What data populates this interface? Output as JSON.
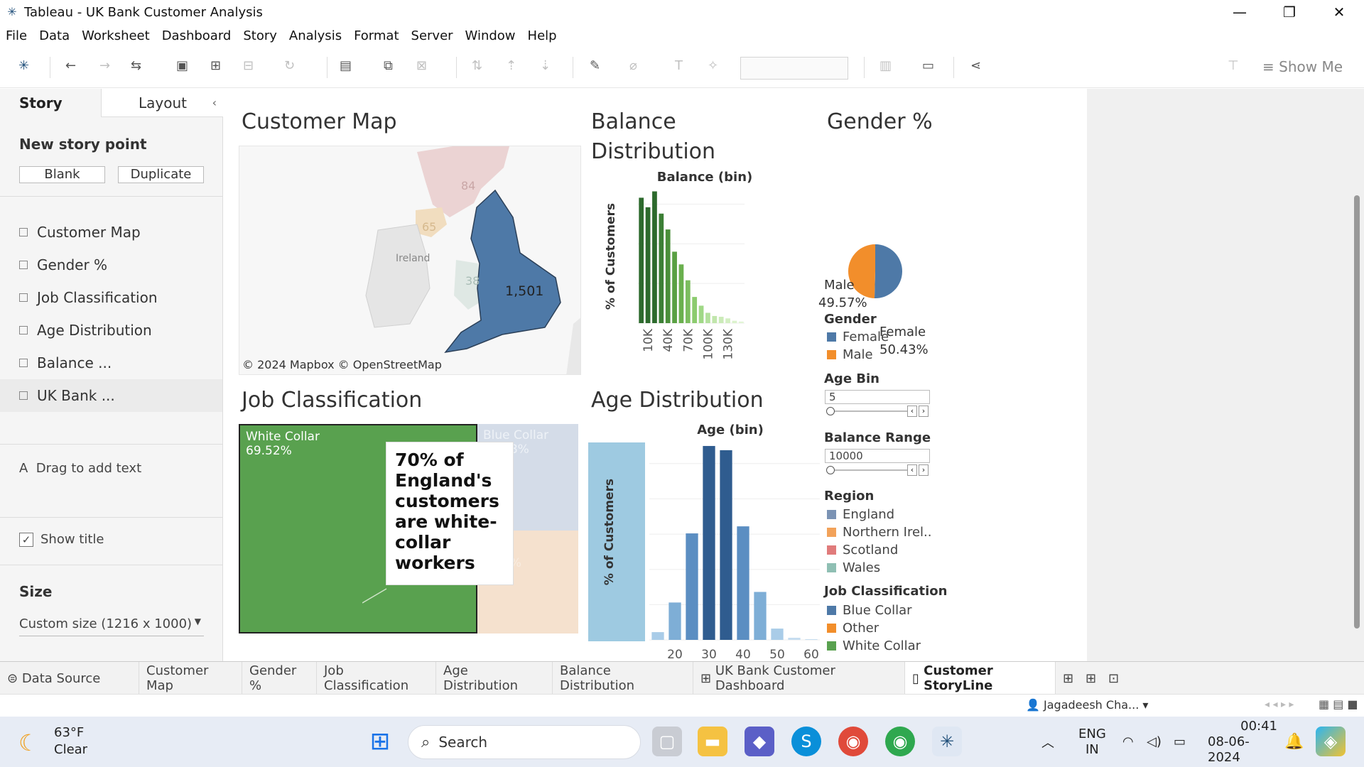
{
  "window": {
    "title": "Tableau - UK Bank Customer Analysis",
    "minimize": "—",
    "maximize": "❐",
    "close": "✕"
  },
  "menu": [
    "File",
    "Data",
    "Worksheet",
    "Dashboard",
    "Story",
    "Analysis",
    "Format",
    "Server",
    "Window",
    "Help"
  ],
  "toolbar": {
    "show_me": "Show Me"
  },
  "story_pane": {
    "tab_story": "Story",
    "tab_layout": "Layout",
    "new_story_point": "New story point",
    "blank": "Blank",
    "duplicate": "Duplicate",
    "sheets": [
      "Customer Map",
      "Gender %",
      "Job Classification",
      "Age Distribution",
      "Balance ...",
      "UK Bank ..."
    ],
    "drag_text": "Drag to add text",
    "show_title": "Show title",
    "size_heading": "Size",
    "size_value": "Custom size (1216 x 1000)"
  },
  "map": {
    "title": "Customer Map",
    "value_england": "1,501",
    "value_scotland": "84",
    "value_ni": "65",
    "value_wales": "38",
    "ireland_label": "Ireland",
    "copyright": "© 2024 Mapbox © OpenStreetMap"
  },
  "balance_chart": {
    "title": "Balance Distribution",
    "header": "Balance (bin)",
    "ylabel": "% of Customers"
  },
  "gender": {
    "title": "Gender %",
    "male_label": "Male",
    "male_pct": "49.57%",
    "female_label": "Female",
    "female_pct": "50.43%"
  },
  "legends": {
    "gender_title": "Gender",
    "gender_items": [
      {
        "label": "Female",
        "color": "#4e79a7"
      },
      {
        "label": "Male",
        "color": "#f28e2b"
      }
    ],
    "age_bin_title": "Age Bin",
    "age_bin_value": "5",
    "balance_range_title": "Balance Range",
    "balance_range_value": "10000",
    "region_title": "Region",
    "region_items": [
      {
        "label": "England",
        "color": "#7b93b4"
      },
      {
        "label": "Northern Irel..",
        "color": "#f2a25a"
      },
      {
        "label": "Scotland",
        "color": "#e07b7b"
      },
      {
        "label": "Wales",
        "color": "#8fbfb3"
      }
    ],
    "job_title": "Job Classification",
    "job_items": [
      {
        "label": "Blue Collar",
        "color": "#4e79a7"
      },
      {
        "label": "Other",
        "color": "#f28e2b"
      },
      {
        "label": "White Collar",
        "color": "#59a14f"
      }
    ]
  },
  "job": {
    "title": "Job Classification",
    "white_label": "White Collar",
    "white_pct": "69.52%",
    "blue_label": "Blue Collar",
    "blue_pct": "22.08%",
    "other_pct": "8.40%",
    "annotation": "70% of England's customers are white-collar workers"
  },
  "age_chart": {
    "title": "Age Distribution",
    "header": "Age (bin)",
    "ylabel": "% of Customers"
  },
  "chart_data": [
    {
      "type": "bar",
      "title": "Balance Distribution",
      "xlabel": "Balance (bin)",
      "ylabel": "% of Customers",
      "x_ticks": [
        "10K",
        "40K",
        "70K",
        "100K",
        "130K"
      ],
      "y_ticks": [
        "0%",
        "5%",
        "10%",
        "15%"
      ],
      "ylim": [
        0,
        17
      ],
      "categories": [
        0,
        10000,
        20000,
        30000,
        40000,
        50000,
        60000,
        70000,
        80000,
        90000,
        100000,
        110000,
        120000,
        130000,
        140000,
        150000
      ],
      "values": [
        15.8,
        14.6,
        16.6,
        13.8,
        11.8,
        9.0,
        7.4,
        5.4,
        3.3,
        2.2,
        1.3,
        0.9,
        0.8,
        0.6,
        0.3,
        0.2
      ],
      "colors": [
        "#2d6a2d",
        "#2d6a2d",
        "#2d6a2d",
        "#3c7f35",
        "#4a8f3a",
        "#5aa043",
        "#6ab04e",
        "#7cbd5f",
        "#8ccb6e",
        "#a0d886",
        "#b3e09c",
        "#c1e6ac",
        "#cbebb8",
        "#d3efc2",
        "#dbf2cc",
        "#e2f5d6"
      ]
    },
    {
      "type": "pie",
      "title": "Gender %",
      "slices": [
        {
          "label": "Female",
          "value": 50.43,
          "color": "#4e79a7"
        },
        {
          "label": "Male",
          "value": 49.57,
          "color": "#f28e2b"
        }
      ]
    },
    {
      "type": "bar",
      "title": "Age Distribution",
      "xlabel": "Age (bin)",
      "ylabel": "% of Customers",
      "x_ticks": [
        "20",
        "30",
        "40",
        "50",
        "60"
      ],
      "y_ticks": [
        "0%",
        "5%",
        "10%",
        "15%",
        "20%",
        "25%"
      ],
      "ylim": [
        0,
        28
      ],
      "categories": [
        15,
        20,
        25,
        30,
        35,
        40,
        45,
        50,
        55,
        60
      ],
      "values": [
        1.1,
        5.3,
        15.1,
        27.5,
        26.9,
        16.1,
        6.8,
        1.6,
        0.3,
        0.1
      ],
      "colors": [
        "#a9cce8",
        "#7eaed6",
        "#5b8ec2",
        "#2f5c8f",
        "#2f5c8f",
        "#5b8ec2",
        "#7eaed6",
        "#a9cce8",
        "#c6ddf0",
        "#c6ddf0"
      ]
    },
    {
      "type": "treemap",
      "title": "Job Classification",
      "items": [
        {
          "label": "White Collar",
          "value": 69.52,
          "color": "#59a14f"
        },
        {
          "label": "Blue Collar",
          "value": 22.08,
          "color": "#4e79a7"
        },
        {
          "label": "Other",
          "value": 8.4,
          "color": "#f28e2b"
        }
      ]
    }
  ],
  "bottom_tabs": [
    "Data Source",
    "Customer Map",
    "Gender %",
    "Job Classification",
    "Age Distribution",
    "Balance Distribution",
    "UK Bank Customer Dashboard",
    "Customer StoryLine"
  ],
  "status": {
    "user": "Jagadeesh Cha..."
  },
  "taskbar": {
    "weather_temp": "63°F",
    "weather_desc": "Clear",
    "search": "Search",
    "lang1": "ENG",
    "lang2": "IN",
    "time": "00:41",
    "date": "08-06-2024"
  }
}
